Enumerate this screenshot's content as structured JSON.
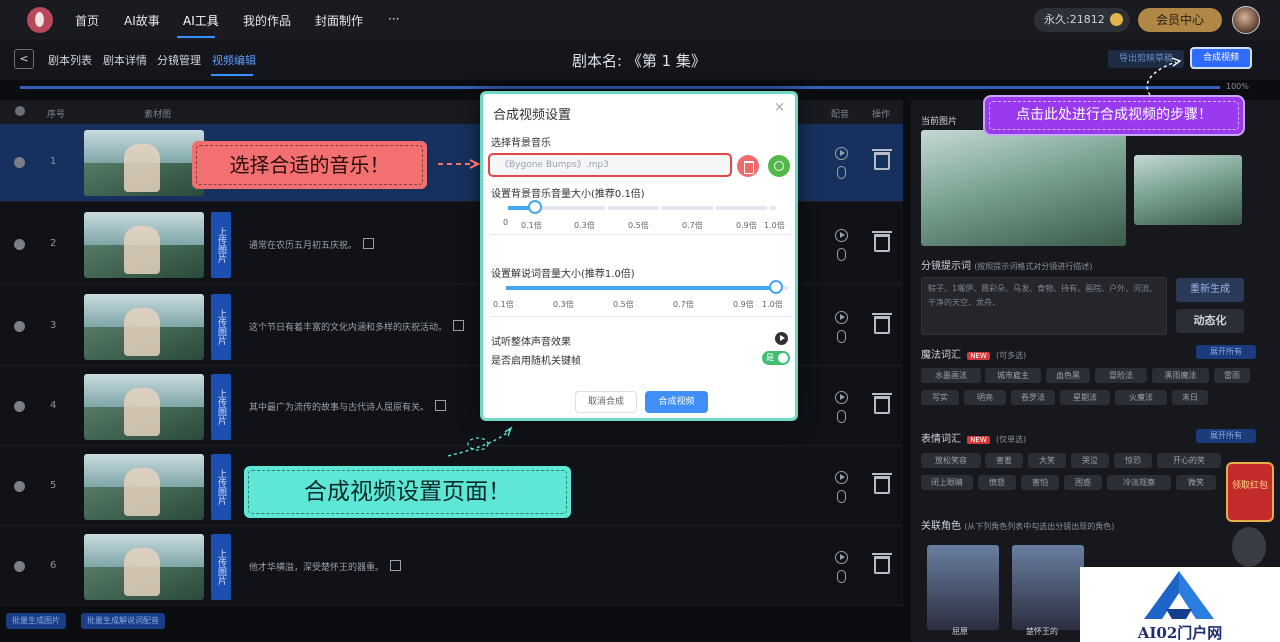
{
  "topnav": {
    "items": [
      {
        "label": "首页",
        "active": false
      },
      {
        "label": "AI故事",
        "active": false
      },
      {
        "label": "AI工具",
        "active": true
      },
      {
        "label": "我的作品",
        "active": false
      },
      {
        "label": "封面制作",
        "active": false
      },
      {
        "label": "···",
        "active": false
      }
    ],
    "credits": "永久:21812",
    "member_label": "会员中心"
  },
  "subnav": {
    "items": [
      {
        "label": "剧本列表",
        "active": false
      },
      {
        "label": "剧本详情",
        "active": false
      },
      {
        "label": "分镜管理",
        "active": false
      },
      {
        "label": "视频编辑",
        "active": true
      }
    ],
    "script_name": "剧本名: 《第 1 集》",
    "export_label": "导出剪映草稿",
    "merge_label": "合成视频",
    "progress_label": "100%",
    "progress_value": 1.0
  },
  "table": {
    "headers": {
      "seq": "序号",
      "image": "素材图",
      "dub": "配音",
      "ops": "操作"
    },
    "upload_label": "上传图片",
    "rows": [
      {
        "num": "1",
        "text": "",
        "selected": true
      },
      {
        "num": "2",
        "text": "通常在农历五月初五庆祝。",
        "selected": false
      },
      {
        "num": "3",
        "text": "这个节日有着丰富的文化内涵和多样的庆祝活动。",
        "selected": false
      },
      {
        "num": "4",
        "text": "其中最广为流传的故事与古代诗人屈原有关。",
        "selected": false
      },
      {
        "num": "5",
        "text": "",
        "selected": false
      },
      {
        "num": "6",
        "text": "他才华横溢，深受楚怀王的器重。",
        "selected": false
      }
    ],
    "bottom_buttons": [
      "批量生成图片",
      "批量生成解说词配音"
    ]
  },
  "right_panel": {
    "current_image_label": "当前图片",
    "prompt_label": "分镜提示词",
    "prompt_hint": "(按照提示词格式对分镜进行描述)",
    "prompt_text": "粽子、1嘴伊、霞彩朵、马发、食物、持有、画院、户外、河流、干净的天空、龙舟、",
    "regen_label": "重新生成",
    "animate_label": "动态化",
    "magic_label": "魔法词汇",
    "magic_hint": "(可多选)",
    "new_badge": "NEW",
    "expand_label": "展开所有",
    "magic_chips": [
      "水墨画法",
      "城市雇主",
      "血色黑",
      "冒险法",
      "黑雨魔法",
      "雷雨",
      "写实",
      "明亮",
      "卷罗法",
      "星期法",
      "火魔法",
      "末日"
    ],
    "emotion_label": "表情词汇",
    "emotion_hint": "(仅单选)",
    "emotion_chips": [
      "放松笑容",
      "害羞",
      "大笑",
      "哭泣",
      "惊恐",
      "开心的笑",
      "闭上眼睛",
      "愤怒",
      "害怕",
      "困惑",
      "冷淡观察",
      "微笑"
    ],
    "character_label": "关联角色",
    "character_hint": "(从下列角色列表中勾选出分镜出现的角色)",
    "characters": [
      "屈原",
      "楚怀王的"
    ],
    "redpacket_text": "领取红包"
  },
  "modal": {
    "title": "合成视频设置",
    "close_icon": "×",
    "music_label": "选择背景音乐",
    "music_value": "《Bygone Bumps》.mp3",
    "bg_volume_label": "设置背景音乐音量大小(推荐0.1倍)",
    "bg_volume_value": 0.1,
    "bg_ticks": [
      "0",
      "0.1倍",
      "0.3倍",
      "0.5倍",
      "0.7倍",
      "0.9倍",
      "1.0倍"
    ],
    "narration_volume_label": "设置解说词音量大小(推荐1.0倍)",
    "narration_volume_value": 1.0,
    "narration_ticks": [
      "0.1倍",
      "0.3倍",
      "0.5倍",
      "0.7倍",
      "0.9倍",
      "1.0倍"
    ],
    "preview_label": "试听整体声音效果",
    "random_keyframe_label": "是否启用随机关键帧",
    "switch_label": "是",
    "cancel_label": "取消合成",
    "confirm_label": "合成视频"
  },
  "annotations": {
    "music": "选择合适的音乐！",
    "merge": "点击此处进行合成视频的步骤！",
    "page": "合成视频设置页面！"
  },
  "watermark": {
    "text": "AI02门户网"
  },
  "colors": {
    "accent": "#3a8fff",
    "modal_border": "#6fd9c7",
    "callout_red": "#f37070",
    "callout_purple": "#9a3af0",
    "callout_teal": "#5fe7d6",
    "switch_on": "#3fbf74"
  }
}
